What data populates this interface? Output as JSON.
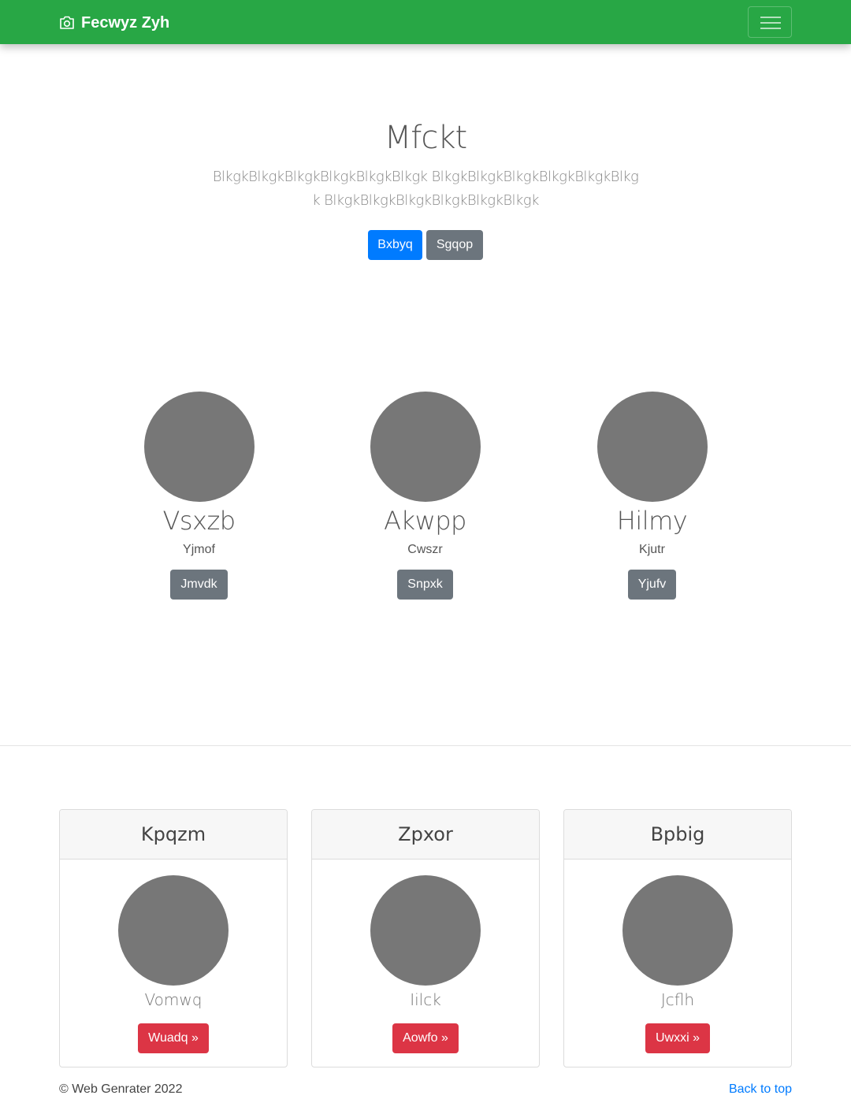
{
  "navbar": {
    "brand": "Fecwyz Zyh",
    "brand_icon": "camera-icon",
    "toggler_icon": "hamburger-menu-icon",
    "color": "#28a745"
  },
  "hero": {
    "title": "Mfckt",
    "lead": "BlkgkBlkgkBlkgkBlkgkBlkgkBlkgk BlkgkBlkgkBlkgkBlkgkBlkgkBlkgk BlkgkBlkgkBlkgkBlkgkBlkgkBlkgk",
    "primary_button": "Bxbyq",
    "secondary_button": "Sgqop"
  },
  "people": [
    {
      "name": "Vsxzb",
      "role": "Yjmof",
      "button": "Jmvdk"
    },
    {
      "name": "Akwpp",
      "role": "Cwszr",
      "button": "Snpxk"
    },
    {
      "name": "Hilmy",
      "role": "Kjutr",
      "button": "Yjufv"
    }
  ],
  "cards": [
    {
      "title": "Kpqzm",
      "subtitle": "Vomwq",
      "button": "Wuadq »"
    },
    {
      "title": "Zpxor",
      "subtitle": "Iilck",
      "button": "Aowfo »"
    },
    {
      "title": "Bpbig",
      "subtitle": "Jcflh",
      "button": "Uwxxi »"
    }
  ],
  "footer": {
    "copyright": "© Web Genrater 2022",
    "back_to_top": "Back to top"
  },
  "colors": {
    "primary": "#007bff",
    "secondary": "#6c757d",
    "danger": "#dc3545",
    "avatar": "#777777"
  }
}
